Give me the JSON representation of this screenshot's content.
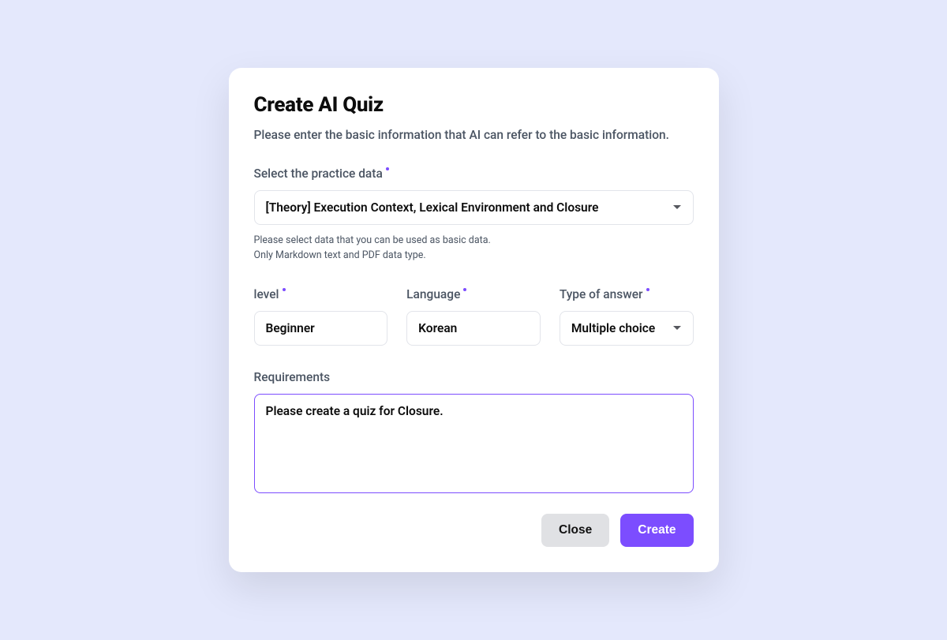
{
  "modal": {
    "title": "Create AI Quiz",
    "subtitle": "Please enter the basic information that AI can refer to the basic information."
  },
  "practice_data": {
    "label": "Select the practice data",
    "value": "[Theory] Execution Context, Lexical Environment and Closure",
    "helper_line1": "Please select data that you can be used as basic data.",
    "helper_line2": "Only Markdown text and PDF data type."
  },
  "level": {
    "label": "level",
    "value": "Beginner"
  },
  "language": {
    "label": "Language",
    "value": "Korean"
  },
  "answer_type": {
    "label": "Type of answer",
    "value": "Multiple choice"
  },
  "requirements": {
    "label": "Requirements",
    "value": "Please create a quiz for Closure."
  },
  "actions": {
    "close": "Close",
    "create": "Create"
  }
}
